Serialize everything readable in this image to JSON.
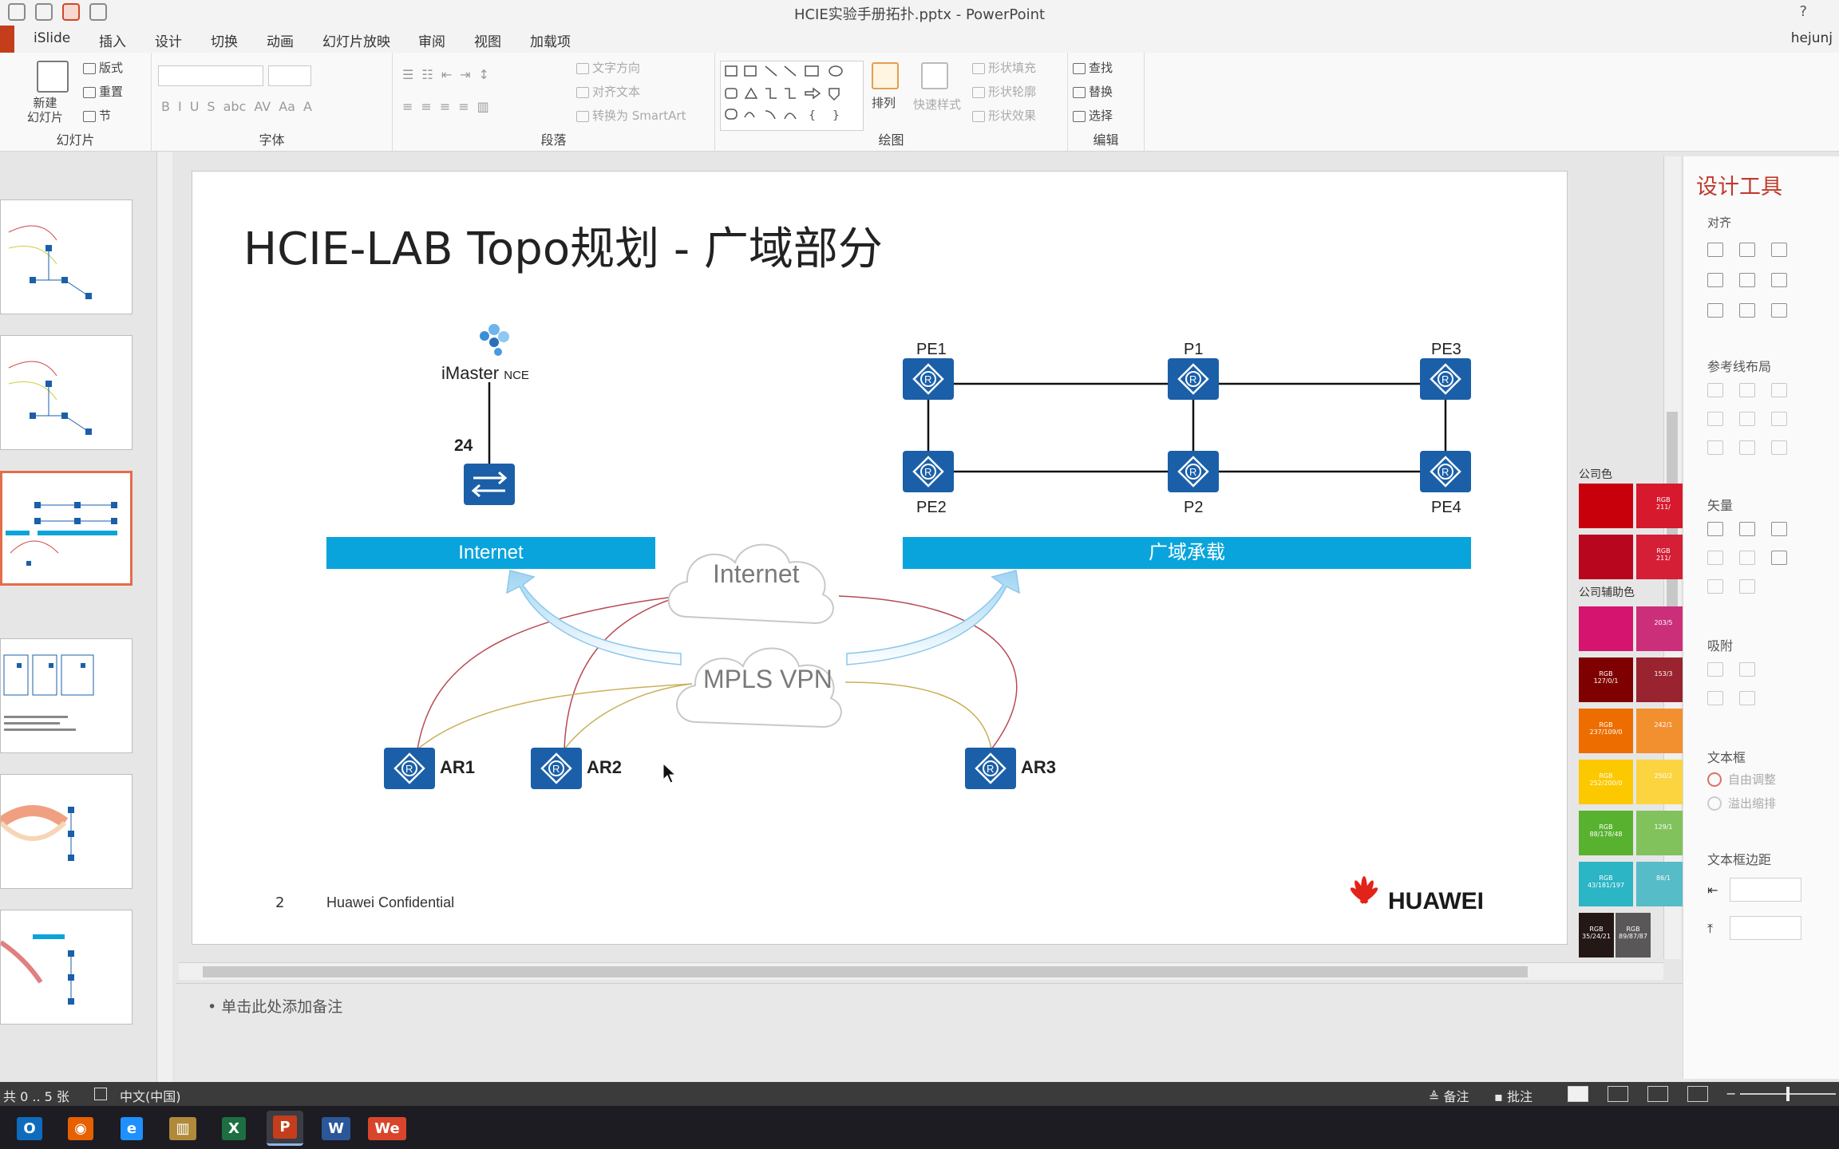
{
  "window": {
    "title": "HCIE实验手册拓扑.pptx - PowerPoint",
    "help": "?"
  },
  "tabs": [
    "iSlide",
    "插入",
    "设计",
    "切换",
    "动画",
    "幻灯片放映",
    "审阅",
    "视图",
    "加载项"
  ],
  "user": "hejunj",
  "ribbon": {
    "slides": {
      "new_slide": "新建\n幻灯片",
      "layout": "版式",
      "reset": "重置",
      "section": "节",
      "label": "幻灯片"
    },
    "font": {
      "label": "字体"
    },
    "paragraph": {
      "text_direction": "文字方向",
      "align_text": "对齐文本",
      "smartart": "转换为 SmartArt",
      "label": "段落"
    },
    "drawing": {
      "arrange": "排列",
      "quick_styles": "快速样式",
      "shape_fill": "形状填充",
      "shape_outline": "形状轮廓",
      "shape_effects": "形状效果",
      "label": "绘图"
    },
    "editing": {
      "find": "查找",
      "replace": "替换",
      "select": "选择",
      "label": "编辑"
    }
  },
  "slide": {
    "title": "HCIE-LAB Topo规划 - 广域部分",
    "imaster_label": "iMaster",
    "imaster_sub": "NCE",
    "port_label": "24",
    "bars": {
      "internet": "Internet",
      "wan": "广域承载"
    },
    "clouds": {
      "internet": "Internet",
      "mpls": "MPLS VPN"
    },
    "routers": [
      "PE1",
      "P1",
      "PE3",
      "PE2",
      "P2",
      "PE4"
    ],
    "access": [
      "AR1",
      "AR2",
      "AR3"
    ],
    "footer": {
      "page": "2",
      "confidential": "Huawei Confidential",
      "brand": "HUAWEI"
    }
  },
  "notes": {
    "placeholder": "单击此处添加备注"
  },
  "swatch_panel": {
    "company_colors": "公司色",
    "aux_colors": "公司辅助色",
    "swatches": [
      {
        "color": "#c7000b",
        "text": ""
      },
      {
        "color": "#d7192e",
        "text": "RGB\n211/"
      },
      {
        "color": "#b8061e",
        "text": ""
      },
      {
        "color": "#d41f36",
        "text": "RGB\n211/"
      },
      {
        "color": "#d4146e",
        "text": ""
      },
      {
        "color": "#cc2f7a",
        "text": "203/5"
      },
      {
        "color": "#7f0001",
        "text": "RGB\n127/0/1"
      },
      {
        "color": "#99232f",
        "text": "153/3"
      },
      {
        "color": "#ed6d00",
        "text": "RGB\n237/109/0"
      },
      {
        "color": "#f29030",
        "text": "242/1"
      },
      {
        "color": "#fcc800",
        "text": "RGB\n252/200/0"
      },
      {
        "color": "#fbd440",
        "text": "250/2"
      },
      {
        "color": "#58b230",
        "text": "RGB\n88/178/48"
      },
      {
        "color": "#81c25c",
        "text": "129/1"
      },
      {
        "color": "#2bb5c5",
        "text": "RGB\n43/181/197"
      },
      {
        "color": "#56bcc8",
        "text": "86/1"
      },
      {
        "color": "#231815",
        "text": "RGB\n35/24/21"
      },
      {
        "color": "#595757",
        "text": "RGB\n89/87/87"
      }
    ]
  },
  "design_panel": {
    "title": "设计工具",
    "align": "对齐",
    "guides": "参考线布局",
    "vector": "矢量",
    "snap": "吸附",
    "textbox": "文本框",
    "autofit": "自由调整",
    "overflow": "溢出缩排",
    "margins": "文本框边距"
  },
  "status": {
    "slide_count": "共 0 .. 5 张",
    "language": "中文(中国)",
    "notes_btn": "备注",
    "comments_btn": "批注"
  },
  "taskbar": [
    {
      "name": "outlook",
      "label": "O",
      "color": "#0f6cbd"
    },
    {
      "name": "firefox",
      "label": "◉",
      "color": "#e66000"
    },
    {
      "name": "ie",
      "label": "e",
      "color": "#1e90ff"
    },
    {
      "name": "library",
      "label": "▥",
      "color": "#b08a3a"
    },
    {
      "name": "excel",
      "label": "X",
      "color": "#1d6f42"
    },
    {
      "name": "powerpoint",
      "label": "P",
      "color": "#c43e1c"
    },
    {
      "name": "word",
      "label": "W",
      "color": "#2b579a"
    },
    {
      "name": "wps",
      "label": "We",
      "color": "#d9452b"
    }
  ]
}
